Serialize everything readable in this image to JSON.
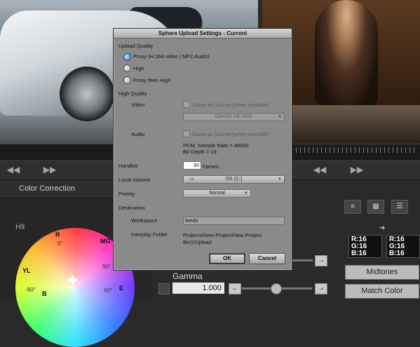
{
  "dialog": {
    "title": "Sphere Upload Settings - Current",
    "upload_quality": {
      "heading": "Upload Quality",
      "options": [
        "Proxy (H.264 video | MP2 Audio)",
        "High",
        "Proxy then High"
      ],
      "selected": "Proxy (H.264 video | MP2 Audio)"
    },
    "high_quality": {
      "heading": "High Quality",
      "video_label": "Video",
      "video_same_as_source": "Same as Source (when possible)",
      "video_format": "DNxHD 145 MXF",
      "audio_label": "Audio",
      "audio_same_as_source": "Same as Source (when possible)",
      "audio_info_line1": "PCM, Sample Rate = 48000",
      "audio_info_line2": "Bit Depth = 16"
    },
    "handles_label": "Handles",
    "handles_value": "30",
    "handles_unit": "frames",
    "local_volume_label": "Local Volume",
    "local_volume_value": "OS (C:)",
    "priority_label": "Priority",
    "priority_value": "Normal",
    "destination_heading": "Destination",
    "workspace_label": "Workspace",
    "workspace_value": "feeds",
    "interplay_folder_label": "Interplay Folder",
    "interplay_folder_line1": "Projects/New Project/New Project",
    "interplay_folder_line2": "Bin1/Upload",
    "ok_label": "OK",
    "cancel_label": "Cancel"
  },
  "editor": {
    "panel_title": "Color Correction",
    "wheel_label": "Hlt",
    "wheel_labels": [
      "R",
      "MG",
      "YL",
      "B",
      "E"
    ],
    "wheel_numbers": [
      "0°",
      "90°",
      "-90°",
      "90°"
    ],
    "gamma_label": "Gamma",
    "gamma_value": "1.000",
    "rgb_left": [
      "R:16",
      "G:16",
      "B:16"
    ],
    "rgb_right": [
      "R:16",
      "G:16",
      "B:16"
    ],
    "midtones_label": "Midtones",
    "match_color_label": "Match Color"
  },
  "icons": {
    "rewind": "double-left-arrow",
    "forward": "double-right-arrow",
    "arrow_right": "right-arrow",
    "arrow_left": "left-arrow"
  },
  "colors": {
    "dialog_bg": "#8a8a8a",
    "radio_selected": "#3b7cc8"
  }
}
